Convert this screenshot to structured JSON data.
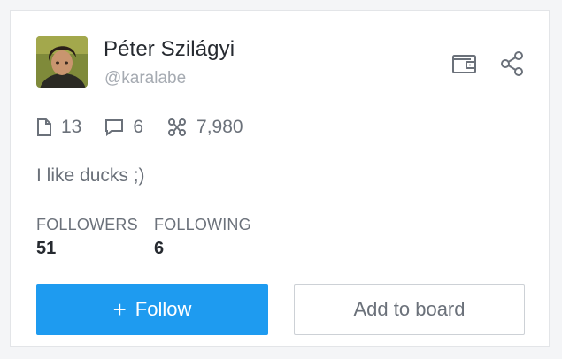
{
  "profile": {
    "name": "Péter Szilágyi",
    "handle": "@karalabe",
    "bio": "I like ducks ;)"
  },
  "stats": {
    "posts": "13",
    "comments": "6",
    "points": "7,980"
  },
  "followers": {
    "label": "FOLLOWERS",
    "value": "51"
  },
  "following": {
    "label": "FOLLOWING",
    "value": "6"
  },
  "actions": {
    "follow_plus": "+",
    "follow_label": "Follow",
    "add_board_label": "Add to board"
  },
  "icons": {
    "wallet": "wallet-icon",
    "share": "share-icon",
    "post": "document-icon",
    "comment": "comment-icon",
    "points": "network-icon"
  },
  "colors": {
    "accent": "#1e9bf0",
    "text_primary": "#262a30",
    "text_secondary": "#6b717a",
    "text_muted": "#a6abb2"
  }
}
